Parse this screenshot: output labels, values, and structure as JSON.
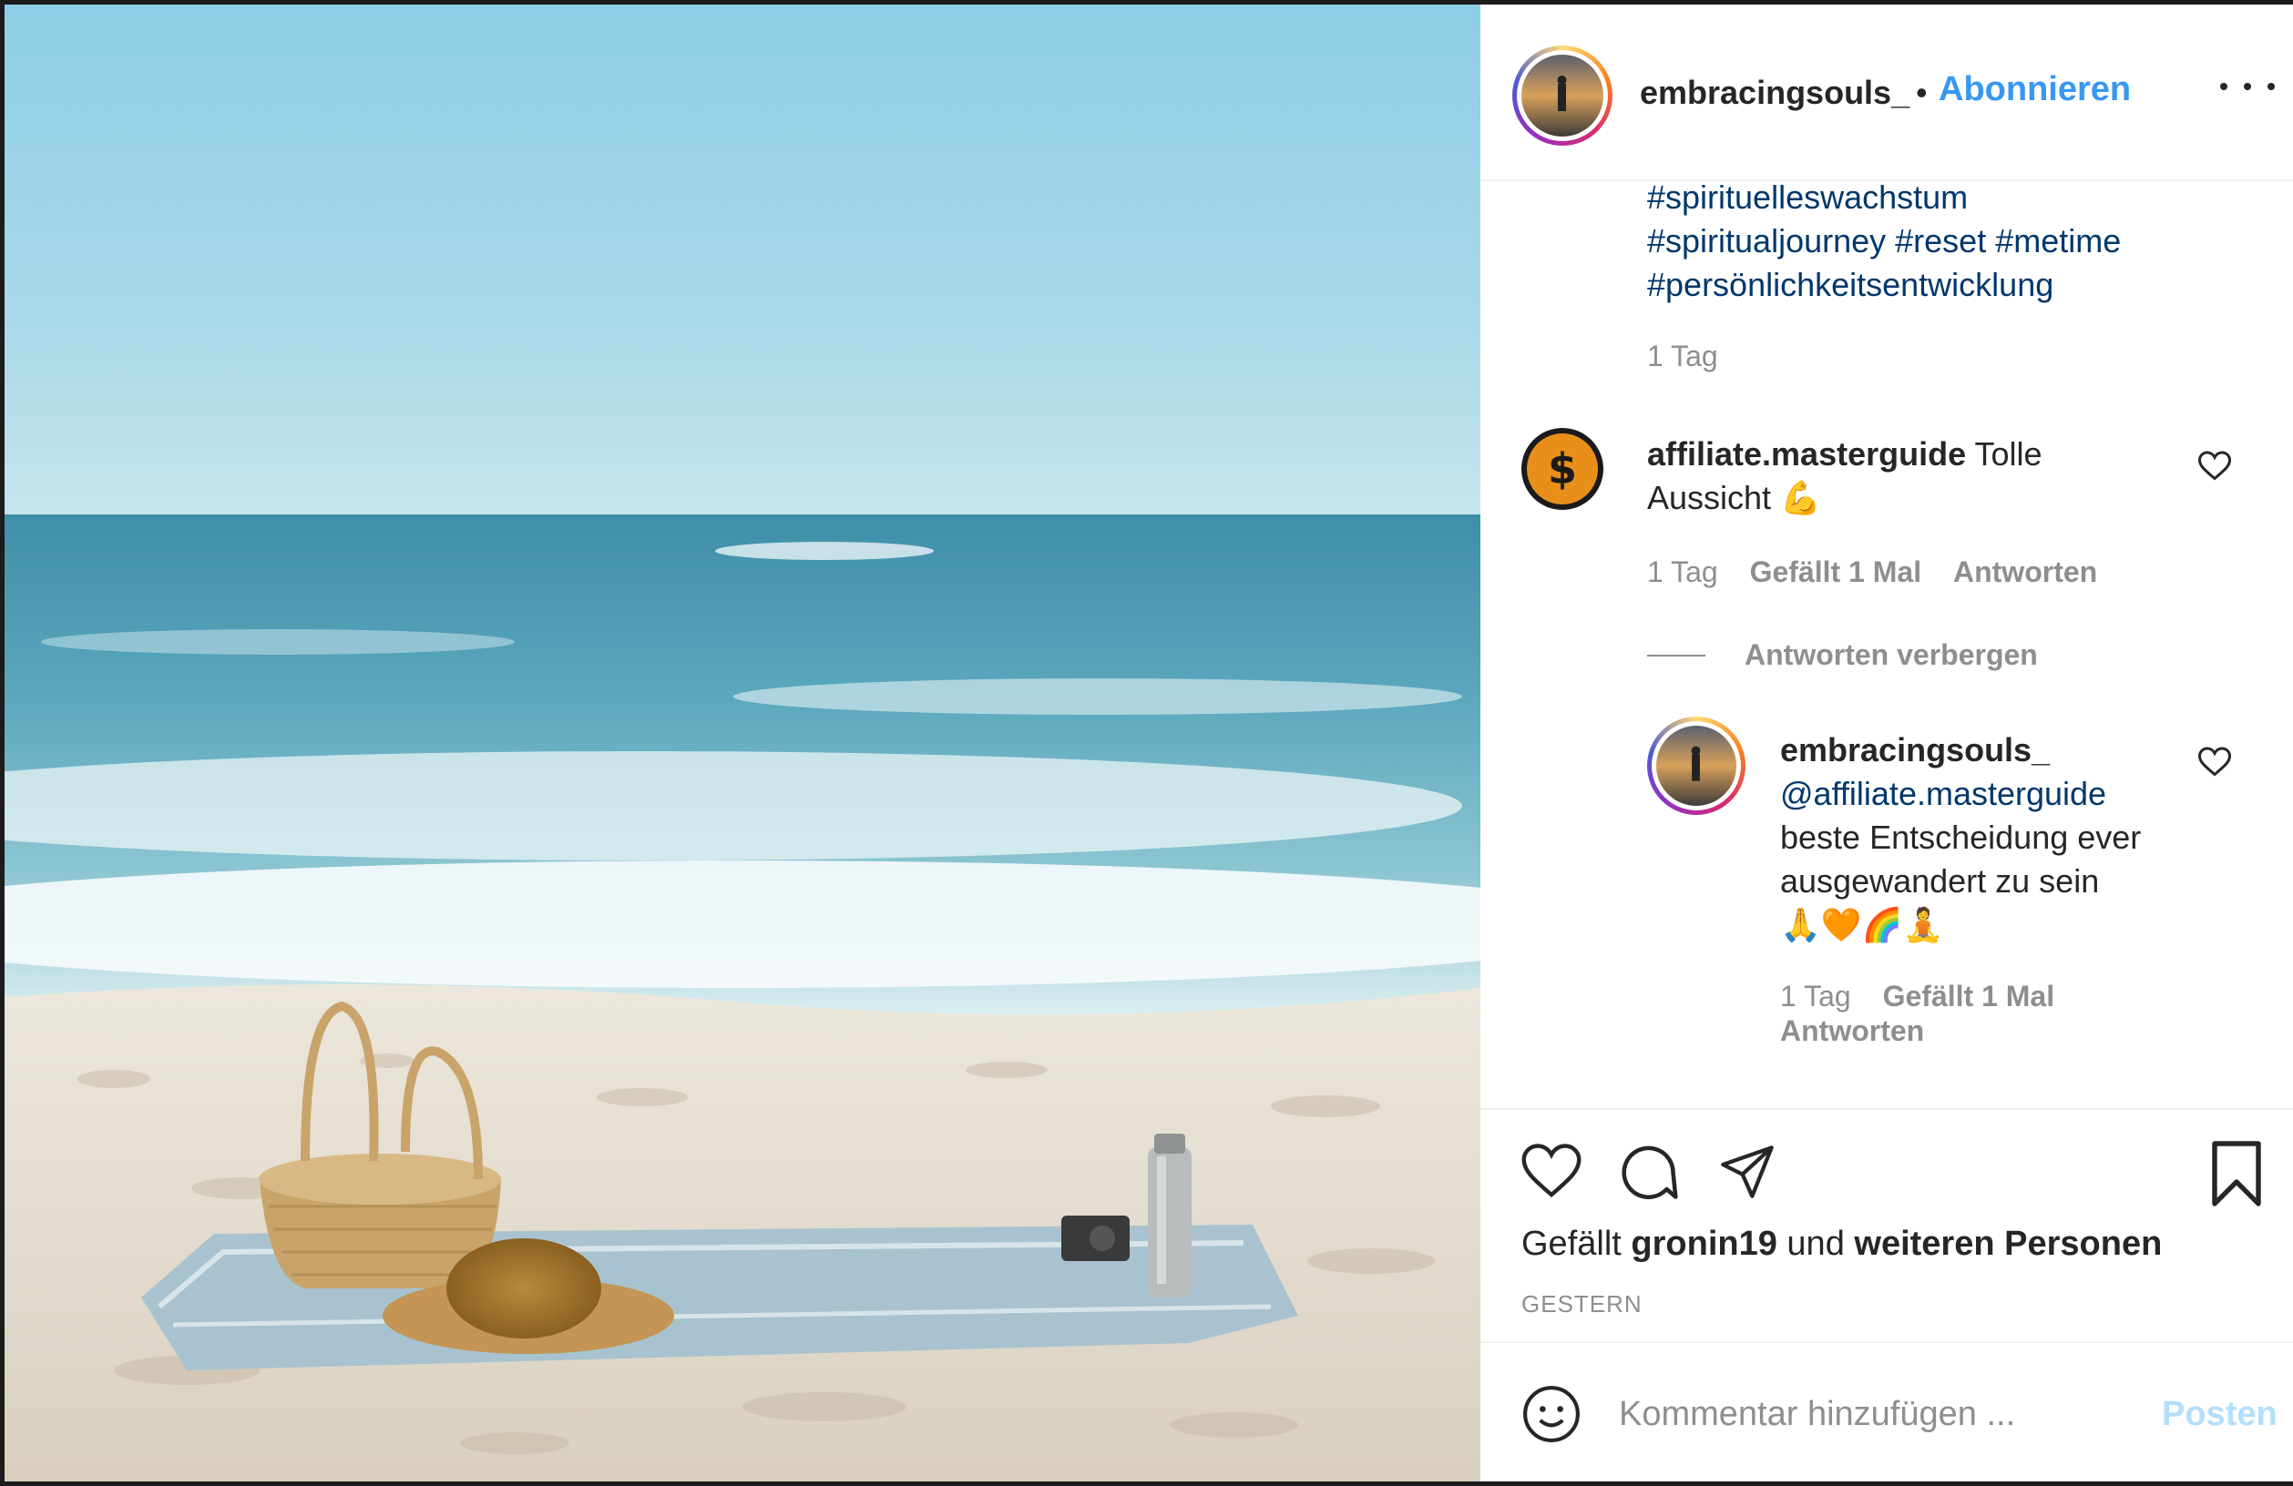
{
  "post": {
    "username": "embracingsouls_",
    "dot": "•",
    "follow_label": "Abonnieren",
    "more_icon": "more-horizontal-icon"
  },
  "caption": {
    "hashtags_line1": "#spirituelleswachstum",
    "hashtags_line2": "#spiritualjourney #reset #metime",
    "hashtags_line3": "#persönlichkeitsentwicklung",
    "time": "1 Tag"
  },
  "comments": [
    {
      "username": "affiliate.masterguide",
      "text_line1": "Tolle",
      "text_line2": "Aussicht",
      "emoji": "💪",
      "time": "1 Tag",
      "likes": "Gefällt 1 Mal",
      "reply": "Antworten",
      "toggle_replies": "Antworten verbergen",
      "reply_item": {
        "username": "embracingsouls_",
        "mention": "@affiliate.masterguide",
        "text_line1": "beste Entscheidung ever",
        "text_line2": "ausgewandert zu sein",
        "emojis": "🙏🧡🌈🧘",
        "time": "1 Tag",
        "likes": "Gefällt 1 Mal",
        "reply": "Antworten"
      }
    }
  ],
  "actions": {
    "like_icon": "heart-icon",
    "comment_icon": "comment-icon",
    "share_icon": "paper-plane-icon",
    "save_icon": "bookmark-icon"
  },
  "likes": {
    "prefix": "Gefällt",
    "user": "gronin19",
    "middle": "und",
    "suffix": "weiteren Personen"
  },
  "date": "GESTERN",
  "add_comment": {
    "placeholder": "Kommentar hinzufügen ...",
    "post_label": "Posten",
    "emoji_icon": "smiley-icon"
  },
  "colors": {
    "link_blue": "#3897f0",
    "hashtag_blue": "#00376b",
    "muted": "#8e8e8e",
    "text": "#262626"
  }
}
